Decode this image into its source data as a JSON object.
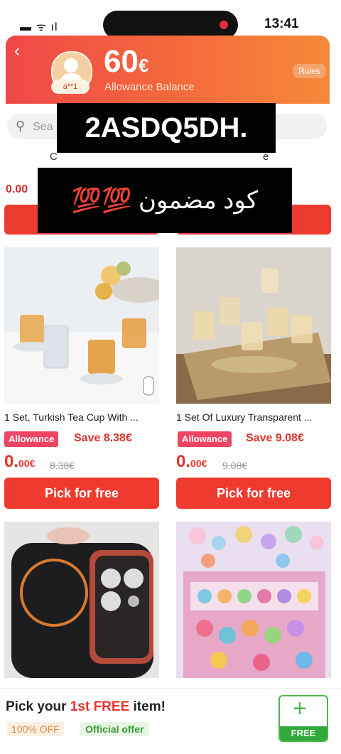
{
  "status_bar": {
    "time": "13:41",
    "signal": "▬ ᯤ ıl"
  },
  "header": {
    "back_icon": "chevron-left-icon",
    "user_tag": "a**1",
    "amount": "60",
    "currency": "€",
    "balance_label": "Allowance Balance",
    "rules_label": "Rules"
  },
  "search": {
    "placeholder": "Sea"
  },
  "tabs": {
    "left": "C",
    "right": "e"
  },
  "price_hint": "0.00",
  "overlay": {
    "code": "2ASDQ5DH.",
    "arabic": "كود مضمون 💯💯"
  },
  "products": [
    {
      "title": "1 Set, Turkish Tea Cup With ...",
      "allowance": "Allowance",
      "save": "Save 8.38€",
      "price_main": "0.",
      "price_small": "00€",
      "original": "8.38€",
      "button": "Pick for free"
    },
    {
      "title": "1 Set Of Luxury Transparent ...",
      "allowance": "Allowance",
      "save": "Save 9.08€",
      "price_main": "0.",
      "price_small": "00€",
      "original": "9.08€",
      "button": "Pick for free"
    }
  ],
  "footer": {
    "title_pre": "Pick your ",
    "title_hl": "1st FREE",
    "title_post": " item!",
    "badge_off": "100% OFF",
    "badge_official": "Official offer",
    "free_label": "FREE"
  },
  "colors": {
    "accent": "#ef3a2f",
    "allowance": "#f04463",
    "free": "#31a93a"
  }
}
